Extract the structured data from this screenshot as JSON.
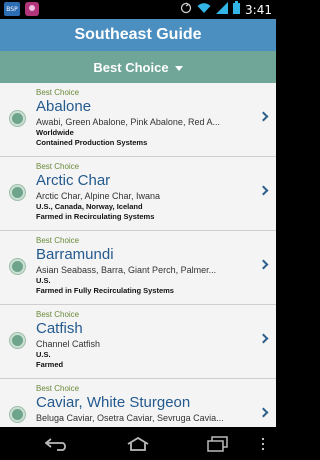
{
  "status_bar": {
    "app_icon_1": "BSP",
    "time": "3:41",
    "icons": [
      "notification-app-icon",
      "photo-app-icon",
      "sync-icon",
      "wifi-icon",
      "signal-icon",
      "battery-icon"
    ]
  },
  "header": {
    "title": "Southeast Guide"
  },
  "filter": {
    "label": "Best Choice"
  },
  "items": [
    {
      "rating": "Best Choice",
      "name": "Abalone",
      "aliases": "Awabi, Green Abalone, Pink Abalone, Red A...",
      "origin": "Worldwide",
      "method": "Contained Production Systems"
    },
    {
      "rating": "Best Choice",
      "name": "Arctic Char",
      "aliases": "Arctic Char, Alpine Char, Iwana",
      "origin": "U.S., Canada, Norway, Iceland",
      "method": "Farmed in Recirculating Systems"
    },
    {
      "rating": "Best Choice",
      "name": "Barramundi",
      "aliases": "Asian Seabass, Barra, Giant Perch, Palmer...",
      "origin": "U.S.",
      "method": "Farmed in Fully Recirculating Systems"
    },
    {
      "rating": "Best Choice",
      "name": "Catfish",
      "aliases": "Channel Catfish",
      "origin": "U.S.",
      "method": "Farmed"
    },
    {
      "rating": "Best Choice",
      "name": "Caviar, White Sturgeon",
      "aliases": "Beluga Caviar, Osetra Caviar, Sevruga Cavia...",
      "origin": "",
      "method": ""
    }
  ],
  "colors": {
    "header_bg": "#4b8ec0",
    "filter_bg": "#6fa698",
    "rating_text": "#6b8b3a",
    "name_text": "#245a8e",
    "dot": "#6ea48a"
  }
}
